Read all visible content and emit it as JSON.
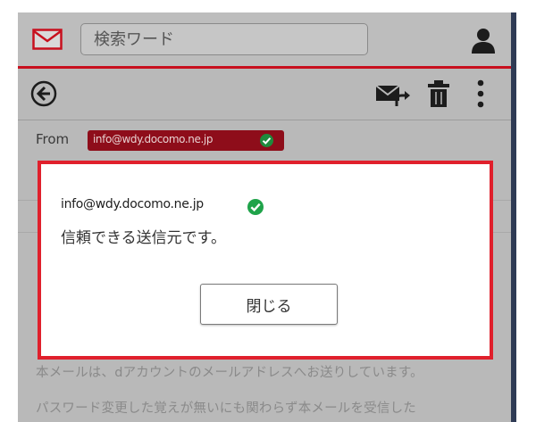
{
  "header": {
    "search_placeholder": "検索ワード"
  },
  "message": {
    "from_label": "From",
    "sender": "info@wdy.docomo.ne.jp",
    "body_lines": [
      "本メールは、dアカウントのメールアドレスへお送りしています。",
      "パスワード変更した覚えが無いにも関わらず本メールを受信した"
    ]
  },
  "dialog": {
    "sender": "info@wdy.docomo.ne.jp",
    "message": "信頼できる送信元です。",
    "close_label": "閉じる"
  },
  "colors": {
    "accent_red": "#e0202c",
    "header_rule": "#c8101e",
    "chip_bg": "#8e0d1a",
    "verified_green": "#1fa34a"
  },
  "icons": {
    "app": "mail-icon",
    "account": "account-icon",
    "back": "back-arrow-icon",
    "reply": "reply-mail-icon",
    "delete": "trash-icon",
    "more": "more-vertical-icon",
    "verified": "check-circle-icon"
  }
}
